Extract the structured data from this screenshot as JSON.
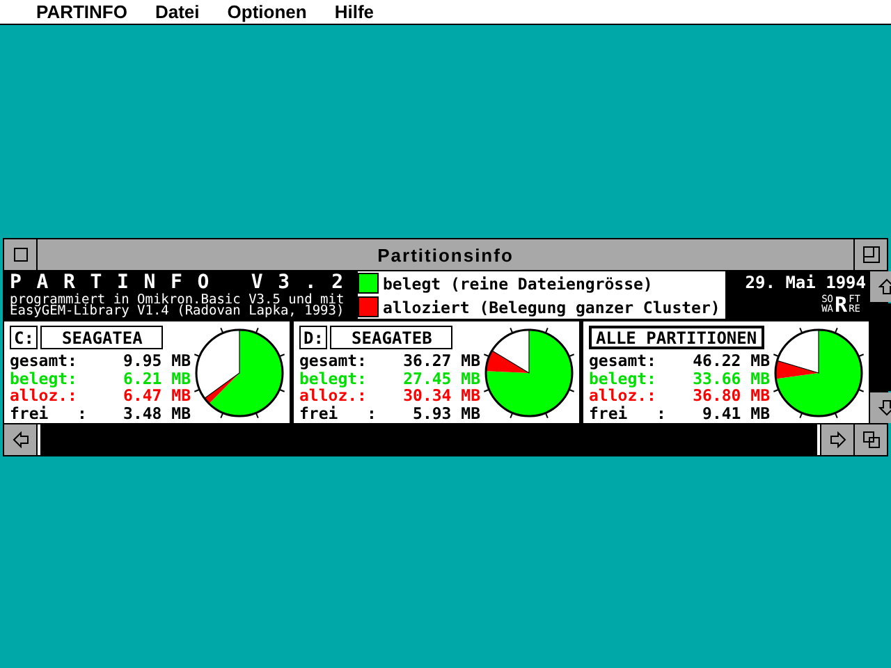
{
  "menu": [
    {
      "label": "PARTINFO"
    },
    {
      "label": "Datei"
    },
    {
      "label": "Optionen"
    },
    {
      "label": "Hilfe"
    }
  ],
  "window": {
    "title": "Partitionsinfo"
  },
  "header": {
    "title": "P A R T I N F O   V 3 . 2",
    "credits": [
      "programmiert in Omikron.Basic V3.5 und mit",
      "EasyGEM-Library V1.4 (Radovan Lapka, 1993)"
    ],
    "legend": [
      {
        "label": "belegt (reine Dateiengrösse)",
        "color": "#00ff00"
      },
      {
        "label": "alloziert (Belegung ganzer Cluster)",
        "color": "#ff0000"
      }
    ],
    "date": "29. Mai 1994",
    "logo": {
      "left": [
        "SO",
        "WA"
      ],
      "letter": "R",
      "right": [
        "FT",
        "RE"
      ]
    }
  },
  "partitions": [
    {
      "drive": "C:",
      "name": "SEAGATEA",
      "rows": [
        {
          "kind": "total",
          "label": "gesamt:",
          "value": "9.95 MB"
        },
        {
          "kind": "used",
          "label": "belegt:",
          "value": "6.21 MB"
        },
        {
          "kind": "alloc",
          "label": "alloz.:",
          "value": "6.47 MB"
        },
        {
          "kind": "free",
          "label": "frei   :",
          "value": "3.48 MB"
        }
      ],
      "chart_data": {
        "type": "pie",
        "values": [
          62.41,
          2.61,
          34.98
        ]
      }
    },
    {
      "drive": "D:",
      "name": "SEAGATEB",
      "rows": [
        {
          "kind": "total",
          "label": "gesamt:",
          "value": "36.27 MB"
        },
        {
          "kind": "used",
          "label": "belegt:",
          "value": "27.45 MB"
        },
        {
          "kind": "alloc",
          "label": "alloz.:",
          "value": "30.34 MB"
        },
        {
          "kind": "free",
          "label": "frei   :",
          "value": "5.93 MB"
        }
      ],
      "chart_data": {
        "type": "pie",
        "values": [
          75.68,
          7.97,
          16.35
        ]
      }
    },
    {
      "name": "ALLE PARTITIONEN",
      "rows": [
        {
          "kind": "total",
          "label": "gesamt:",
          "value": "46.22 MB"
        },
        {
          "kind": "used",
          "label": "belegt:",
          "value": "33.66 MB"
        },
        {
          "kind": "alloc",
          "label": "alloz.:",
          "value": "36.80 MB"
        },
        {
          "kind": "free",
          "label": "frei   :",
          "value": "9.41 MB"
        }
      ],
      "chart_data": {
        "type": "pie",
        "values": [
          72.83,
          6.79,
          20.38
        ]
      }
    }
  ]
}
